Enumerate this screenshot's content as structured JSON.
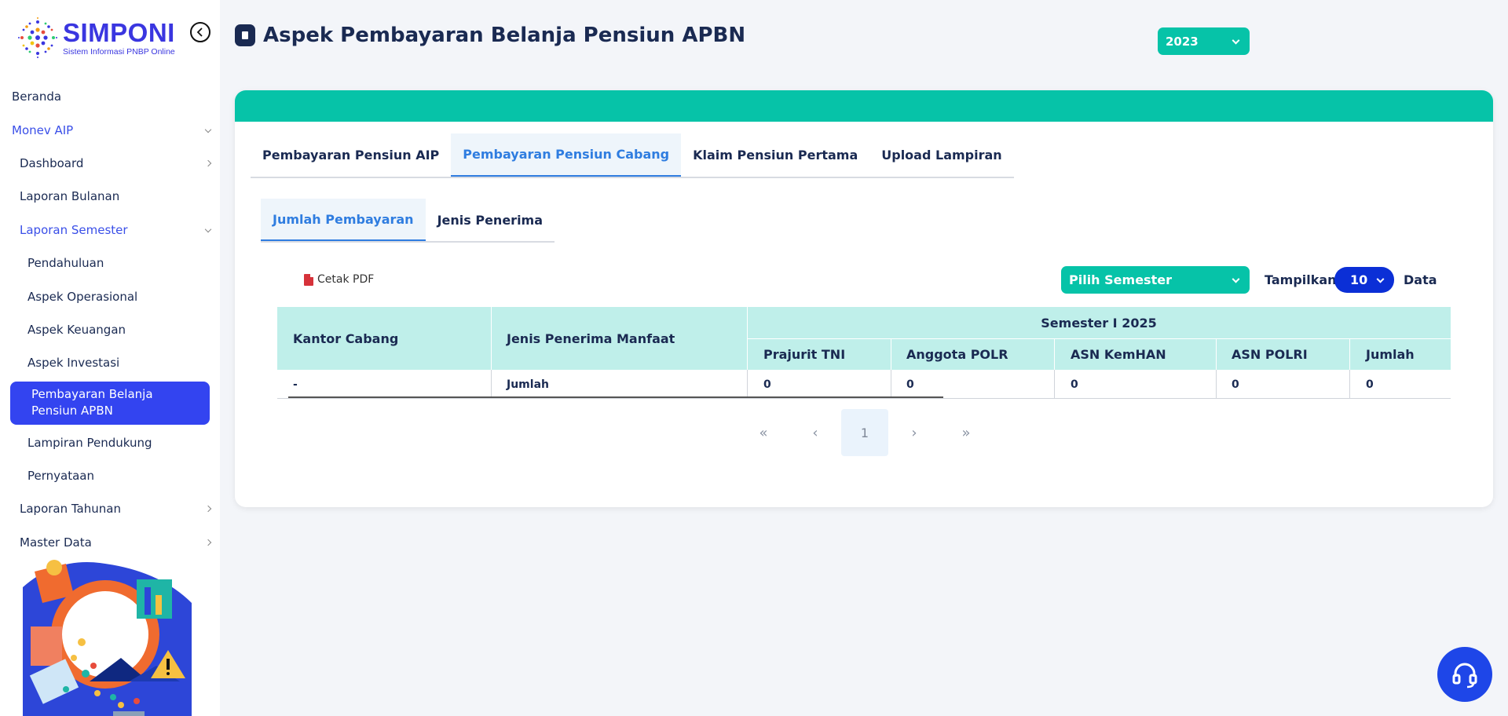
{
  "brand": {
    "name": "SIMPONI",
    "tagline": "Sistem Informasi PNBP Online"
  },
  "sidebar": {
    "items": [
      {
        "label": "Beranda"
      },
      {
        "label": "Monev AIP"
      },
      {
        "label": "Dashboard"
      },
      {
        "label": "Laporan Bulanan"
      },
      {
        "label": "Laporan Semester"
      },
      {
        "label": "Pendahuluan"
      },
      {
        "label": "Aspek Operasional"
      },
      {
        "label": "Aspek Keuangan"
      },
      {
        "label": "Aspek Investasi"
      },
      {
        "label": "Pembayaran Belanja Pensiun APBN"
      },
      {
        "label": "Lampiran Pendukung"
      },
      {
        "label": "Pernyataan"
      },
      {
        "label": "Laporan Tahunan"
      },
      {
        "label": "Master Data"
      }
    ]
  },
  "header": {
    "title": "Aspek Pembayaran Belanja Pensiun APBN",
    "year": "2023"
  },
  "tabs": [
    {
      "label": "Pembayaran Pensiun AIP"
    },
    {
      "label": "Pembayaran Pensiun Cabang"
    },
    {
      "label": "Klaim Pensiun Pertama"
    },
    {
      "label": "Upload Lampiran"
    }
  ],
  "subtabs": [
    {
      "label": "Jumlah Pembayaran"
    },
    {
      "label": "Jenis Penerima"
    }
  ],
  "toolbar": {
    "print_label": "Cetak PDF",
    "semester_placeholder": "Pilih Semester",
    "show_label": "Tampilkan",
    "page_size": "10",
    "data_label": "Data"
  },
  "table": {
    "col_kantor": "Kantor Cabang",
    "col_jenis": "Jenis Penerima Manfaat",
    "group_header": "Semester I 2025",
    "sub_columns": [
      "Prajurit TNI",
      "Anggota POLR",
      "ASN KemHAN",
      "ASN POLRI",
      "Jumlah"
    ],
    "rows": [
      {
        "kantor": "-",
        "jenis": "Jumlah",
        "values": [
          "0",
          "0",
          "0",
          "0",
          "0"
        ]
      }
    ]
  },
  "pagination": {
    "first": "«",
    "prev": "‹",
    "current": "1",
    "next": "›",
    "last": "»"
  },
  "colors": {
    "accent": "#06c3a8",
    "primary": "#3344f0",
    "navy": "#1a2a52",
    "tab_active": "#2f7de0"
  }
}
